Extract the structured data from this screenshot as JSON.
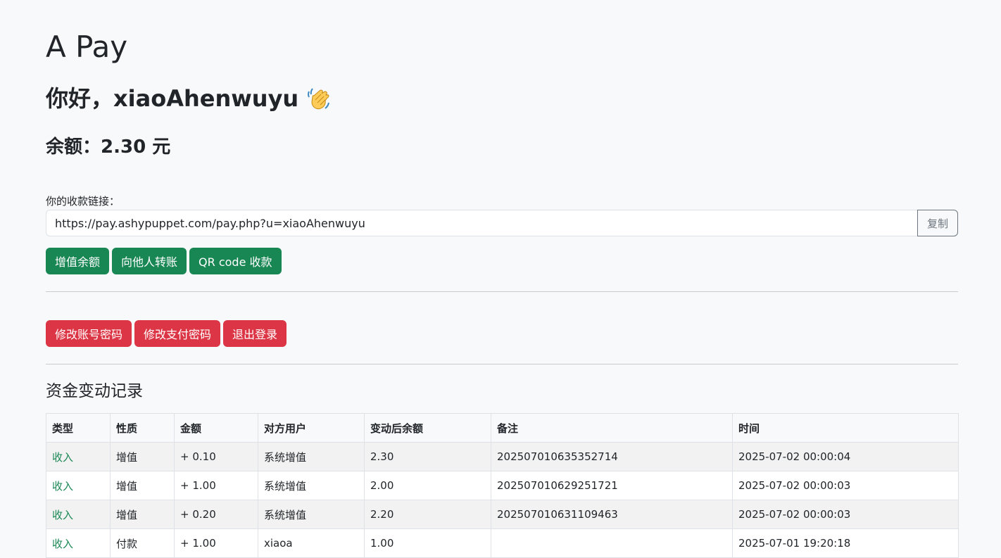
{
  "app": {
    "title": "A Pay",
    "greeting": "你好，xiaoAhenwuyu",
    "greeting_icon": "waving-hand-icon"
  },
  "balance": {
    "label": "余额：",
    "value": "2.30 元"
  },
  "payment_link": {
    "label": "你的收款链接：",
    "value": "https://pay.ashypuppet.com/pay.php?u=xiaoAhenwuyu",
    "copy_label": "复制"
  },
  "actions": {
    "topup": "增值余额",
    "transfer": "向他人转账",
    "qr": "QR code 收款",
    "change_account_password": "修改账号密码",
    "change_pay_password": "修改支付密码",
    "logout": "退出登录"
  },
  "colors": {
    "success": "#198754",
    "danger": "#dc3545",
    "background": "#f8f9fa"
  },
  "records": {
    "title": "资金变动记录",
    "columns": [
      "类型",
      "性质",
      "金额",
      "对方用户",
      "变动后余额",
      "备注",
      "时间"
    ],
    "rows": [
      [
        "收入",
        "增值",
        "+ 0.10",
        "系统增值",
        "2.30",
        "202507010635352714",
        "2025-07-02 00:00:04"
      ],
      [
        "收入",
        "增值",
        "+ 1.00",
        "系统增值",
        "2.00",
        "202507010629251721",
        "2025-07-02 00:00:03"
      ],
      [
        "收入",
        "增值",
        "+ 0.20",
        "系统增值",
        "2.20",
        "202507010631109463",
        "2025-07-02 00:00:03"
      ],
      [
        "收入",
        "付款",
        "+ 1.00",
        "xiaoa",
        "1.00",
        "",
        "2025-07-01 19:20:18"
      ]
    ]
  }
}
